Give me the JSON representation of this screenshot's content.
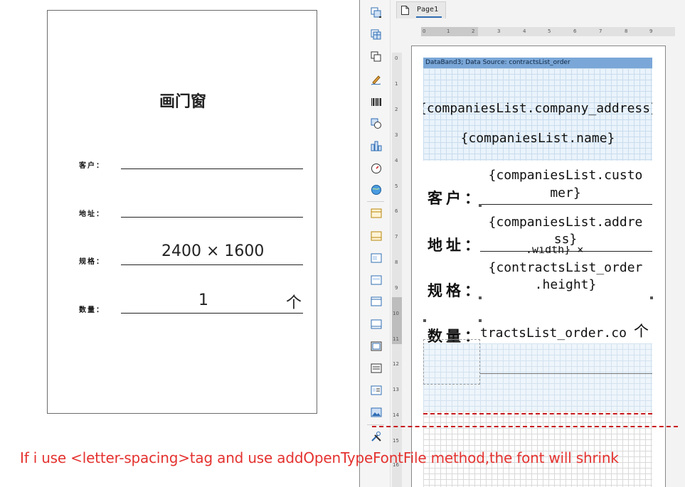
{
  "preview": {
    "title": "画门窗",
    "rows": [
      {
        "label": "客户："
      },
      {
        "label": "地址："
      },
      {
        "label": "规格：",
        "value": "2400 × 1600"
      },
      {
        "label": "数量：",
        "value": "1",
        "unit": "个"
      }
    ]
  },
  "caption": "If i use <letter-spacing>tag and use addOpenTypeFontFile method,the font will shrink",
  "designer": {
    "tab_label": "Page1",
    "ruler_h": [
      "0",
      "1",
      "2",
      "3",
      "4",
      "5",
      "6",
      "7",
      "8",
      "9"
    ],
    "ruler_v": [
      "0",
      "1",
      "2",
      "3",
      "4",
      "5",
      "6",
      "7",
      "8",
      "9",
      "10",
      "11",
      "12",
      "13",
      "14",
      "15",
      "16"
    ],
    "band_title": "DataBand3; Data Source: contractsList_order",
    "fields": {
      "company_address": "{companiesList.company_address}",
      "company_name": "{companiesList.name}",
      "customer_line1": "{companiesList.custo",
      "customer_line2": "mer}",
      "address_line1": "{companiesList.addre",
      "address_line2": "ss}",
      "width_fragment": ".width} ×",
      "height_line1": "{contractsList_order",
      "height_line2": ".height}",
      "count_fragment": "tractsList_order.co",
      "count_unit": "个"
    },
    "labels": {
      "customer": "客户：",
      "address": "地址：",
      "spec": "规格：",
      "quantity": "数量："
    },
    "toolbox_icons": [
      "page-stack-icon",
      "table-icon",
      "shapes-copy-icon",
      "pen-icon",
      "barcode-icon",
      "shape-icon",
      "bar-chart-icon",
      "gauge-icon",
      "globe-icon",
      "band-icon",
      "band-icon",
      "band-icon",
      "band-icon",
      "band-icon",
      "band-icon",
      "band-icon",
      "band-icon",
      "band-icon",
      "band-icon",
      "image-icon",
      "tools-icon"
    ]
  }
}
